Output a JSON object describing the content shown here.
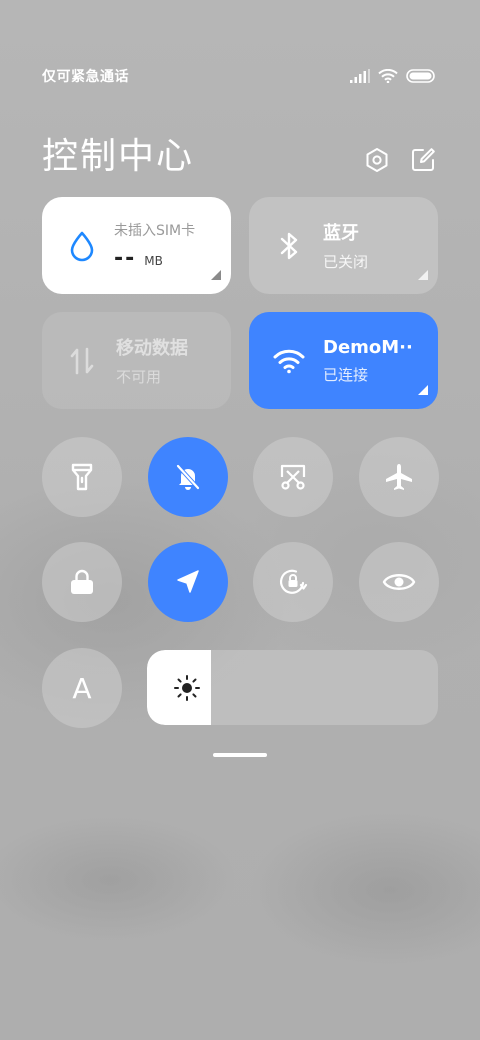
{
  "status": {
    "carrier": "仅可紧急通话"
  },
  "header": {
    "title": "控制中心"
  },
  "tiles": {
    "data_usage": {
      "label": "未插入SIM卡",
      "value": "--",
      "unit": "MB"
    },
    "bluetooth": {
      "label": "蓝牙",
      "state": "已关闭"
    },
    "mobile_data": {
      "label": "移动数据",
      "state": "不可用"
    },
    "wifi": {
      "label": "DemoM··",
      "state": "已连接"
    }
  },
  "toggles": [
    {
      "name": "flashlight",
      "active": false
    },
    {
      "name": "mute",
      "active": true
    },
    {
      "name": "screenshot",
      "active": false
    },
    {
      "name": "airplane-mode",
      "active": false
    },
    {
      "name": "lock-screen",
      "active": false
    },
    {
      "name": "location",
      "active": true
    },
    {
      "name": "auto-rotate",
      "active": false
    },
    {
      "name": "reading-mode",
      "active": false
    },
    {
      "name": "auto-brightness",
      "active": false
    }
  ],
  "auto_brightness": {
    "letter": "A"
  },
  "brightness": {
    "level": 0.22
  },
  "colors": {
    "accent": "#3f84ff",
    "tile_active": "#ffffff"
  }
}
